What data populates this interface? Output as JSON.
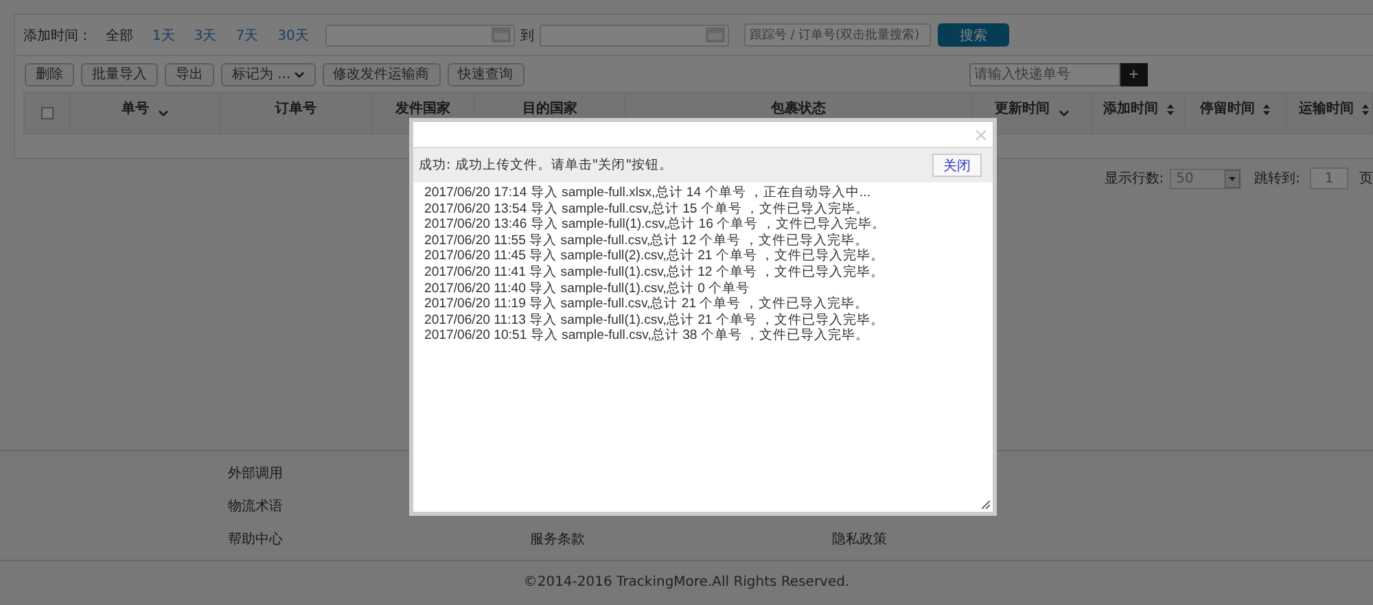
{
  "filter": {
    "label": "添加时间：",
    "ranges": [
      {
        "label": "全部",
        "selected": true
      },
      {
        "label": "1天",
        "selected": false
      },
      {
        "label": "3天",
        "selected": false
      },
      {
        "label": "7天",
        "selected": false
      },
      {
        "label": "30天",
        "selected": false
      }
    ],
    "to_label": "到",
    "search": {
      "placeholder": "跟踪号 / 订单号(双击批量搜索)"
    },
    "search_button": "搜索"
  },
  "toolbar": {
    "buttons": [
      {
        "label": "删除",
        "kind": "plain"
      },
      {
        "label": "批量导入",
        "kind": "plain"
      },
      {
        "label": "导出",
        "kind": "plain"
      },
      {
        "label": "标记为 ...",
        "kind": "menu"
      },
      {
        "label": "修改发件运输商",
        "kind": "plain"
      },
      {
        "label": "快速查询",
        "kind": "plain"
      }
    ],
    "quick_add": {
      "placeholder": "请输入快递单号",
      "button": "+"
    }
  },
  "table": {
    "select_all": {
      "checked": false
    },
    "columns": [
      {
        "label": "单号",
        "kind": "menu"
      },
      {
        "label": "订单号",
        "kind": "plain"
      },
      {
        "label": "发件国家",
        "kind": "plain"
      },
      {
        "label": "目的国家",
        "kind": "plain"
      },
      {
        "label": "包裹状态",
        "kind": "plain"
      },
      {
        "label": "更新时间",
        "kind": "menu"
      },
      {
        "label": "添加时间",
        "kind": "sort"
      },
      {
        "label": "停留时间",
        "kind": "sort"
      },
      {
        "label": "运输时间",
        "kind": "sort"
      }
    ]
  },
  "pagination": {
    "rows_label": "显示行数:",
    "rows_value": "50",
    "jump_label": "跳转到:",
    "jump_value": "1",
    "page_label": "页"
  },
  "dialog": {
    "message": "成功: 成功上传文件。请单击\"关闭\"按钮。",
    "close_button": "关闭",
    "log": [
      "2017/06/20 17:14 导入 sample-full.xlsx,总计 14 个单号 ，正在自动导入中...",
      "2017/06/20 13:54 导入 sample-full.csv,总计 15 个单号 ，文件已导入完毕。",
      "2017/06/20 13:46 导入 sample-full(1).csv,总计 16 个单号 ，文件已导入完毕。",
      "2017/06/20 11:55 导入 sample-full.csv,总计 12 个单号 ，文件已导入完毕。",
      "2017/06/20 11:45 导入 sample-full(2).csv,总计 21 个单号 ，文件已导入完毕。",
      "2017/06/20 11:41 导入 sample-full(1).csv,总计 12 个单号 ，文件已导入完毕。",
      "2017/06/20 11:40 导入 sample-full(1).csv,总计 0 个单号",
      "2017/06/20 11:19 导入 sample-full.csv,总计 21 个单号 ，文件已导入完毕。",
      "2017/06/20 11:13 导入 sample-full(1).csv,总计 21 个单号 ，文件已导入完毕。",
      "2017/06/20 10:51 导入 sample-full.csv,总计 38 个单号 ，文件已导入完毕。"
    ]
  },
  "footer": {
    "columns": [
      [
        "外部调用",
        "物流术语",
        "帮助中心"
      ],
      [
        "服务条款"
      ],
      [
        "隐私政策"
      ]
    ],
    "copyright": "©2014-2016 TrackingMore.All Rights Reserved."
  }
}
